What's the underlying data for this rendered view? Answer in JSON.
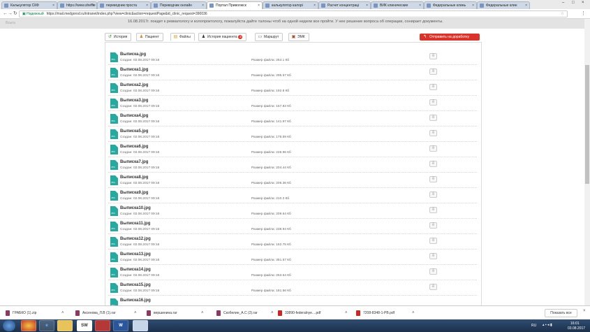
{
  "browser": {
    "tabs": [
      {
        "title": "Калькулятор СКФ",
        "active": false
      },
      {
        "title": "https://www.sheffie",
        "active": false
      },
      {
        "title": "переводчик проста",
        "active": false
      },
      {
        "title": "Переводчик онлайн",
        "active": false
      },
      {
        "title": "Портал Приволжск",
        "active": true
      },
      {
        "title": "калькулятор калорі",
        "active": false
      },
      {
        "title": "Расчет концентраці",
        "active": false
      },
      {
        "title": "ВИК клинические",
        "active": false
      },
      {
        "title": "Федеральные клинь",
        "active": false
      },
      {
        "title": "Федеральные клин",
        "active": false
      }
    ],
    "secure_label": "Надежный",
    "url": "https://mail.medgorod.ru/intranet/index.php?view=clinic&action=requestPage&id_clinic_request=390036"
  },
  "page": {
    "header_left": "Вхыга",
    "notice": "16.08.2017г. поедет к ревматологу и колопроктологу, пожалуйста дайте талоны чтоб на одной недели все пройти. У нее решение вопроса об операции, сонирает документы.",
    "toolbar": {
      "history": "История",
      "patient": "Пациент",
      "files": "Файлы",
      "patient_history": "История пациента",
      "patient_history_badge": "2",
      "route": "Маршрут",
      "emk": "ЭМК",
      "send": "Отправить на доработку"
    },
    "files": [
      {
        "name": "Выписка.jpg",
        "created": "Создан: 02.08.2017 09:16",
        "size": "Размер файла: 264.1 Кб"
      },
      {
        "name": "Выписка1.jpg",
        "created": "Создан: 02.08.2017 09:16",
        "size": "Размер файла: 295.57 Кб"
      },
      {
        "name": "Выписка2.jpg",
        "created": "Создан: 02.08.2017 09:16",
        "size": "Размер файла: 192.8 Кб"
      },
      {
        "name": "Выписка3.jpg",
        "created": "Создан: 02.08.2017 09:16",
        "size": "Размер файла: 157.83 Кб"
      },
      {
        "name": "Выписка4.jpg",
        "created": "Создан: 02.08.2017 09:16",
        "size": "Размер файла: 141.97 Кб"
      },
      {
        "name": "Выписка5.jpg",
        "created": "Создан: 02.08.2017 09:16",
        "size": "Размер файла: 179.59 Кб"
      },
      {
        "name": "Выписка6.jpg",
        "created": "Создан: 02.08.2017 09:16",
        "size": "Размер файла: 226.96 Кб"
      },
      {
        "name": "Выписка7.jpg",
        "created": "Создан: 02.08.2017 09:16",
        "size": "Размер файла: 204.44 Кб"
      },
      {
        "name": "Выписка8.jpg",
        "created": "Создан: 02.08.2017 09:16",
        "size": "Размер файла: 206.36 Кб"
      },
      {
        "name": "Выписка9.jpg",
        "created": "Создан: 02.08.2017 09:16",
        "size": "Размер файла: 210.3 Кб"
      },
      {
        "name": "Выписка10.jpg",
        "created": "Создан: 02.08.2017 09:16",
        "size": "Размер файла: 209.54 Кб"
      },
      {
        "name": "Выписка11.jpg",
        "created": "Создан: 02.08.2017 09:16",
        "size": "Размер файла: 238.94 Кб"
      },
      {
        "name": "Выписка12.jpg",
        "created": "Создан: 02.08.2017 09:16",
        "size": "Размер файла: 152.75 Кб"
      },
      {
        "name": "Выписка13.jpg",
        "created": "Создан: 02.08.2017 09:16",
        "size": "Размер файла: 351.57 Кб"
      },
      {
        "name": "Выписка14.jpg",
        "created": "Создан: 02.08.2017 09:16",
        "size": "Размер файла: 253.54 Кб"
      },
      {
        "name": "Выписка15.jpg",
        "created": "Создан: 02.08.2017 09:16",
        "size": "Размер файла: 181.56 Кб"
      },
      {
        "name": "Выписка16.jpg",
        "created": "",
        "size": ""
      }
    ],
    "file_ext": "JPG"
  },
  "downloads": {
    "items": [
      "ГРАБКО (1).zip",
      "Аксенова_Л.В (1).rar",
      "вершинина.rar",
      "Скобелин_А.С (2).rar",
      "33890-federalnye....pdf",
      "7208-8348-1-PB.pdf"
    ],
    "show_all": "Показать все"
  },
  "taskbar": {
    "lang": "RU",
    "time": "16:01",
    "date": "03.08.2017"
  }
}
